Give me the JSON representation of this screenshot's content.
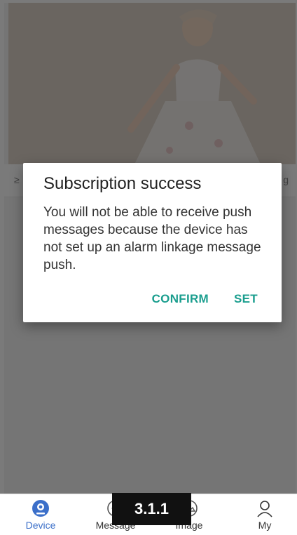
{
  "info_strip": {
    "left_text": "≥",
    "right_text": "g"
  },
  "dialog": {
    "title": "Subscription success",
    "message": "You will not be able to receive push messages because the device has not set up an alarm linkage message push.",
    "confirm_label": "CONFIRM",
    "set_label": "SET"
  },
  "tabbar": {
    "tabs": [
      {
        "label": "Device",
        "icon": "device-icon",
        "active": true
      },
      {
        "label": "Message",
        "icon": "message-icon",
        "active": false
      },
      {
        "label": "Image",
        "icon": "image-icon",
        "active": false
      },
      {
        "label": "My",
        "icon": "person-icon",
        "active": false
      }
    ]
  },
  "watermark": {
    "text": "3.1.1"
  },
  "colors": {
    "accent": "#1a9e8e",
    "active_tab": "#3b6fc9"
  }
}
